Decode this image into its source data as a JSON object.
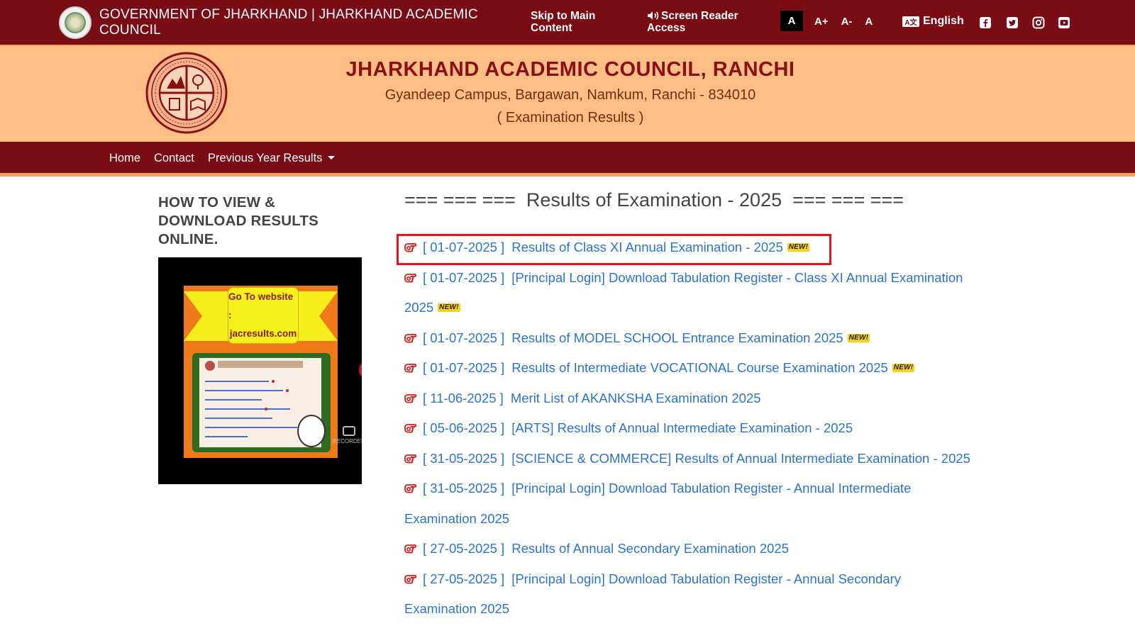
{
  "topbar": {
    "gov_title": "GOVERNMENT OF JHARKHAND | JHARKHAND ACADEMIC COUNCIL",
    "skip_link": "Skip to Main Content",
    "screen_reader": "Screen Reader Access",
    "font_sizes": [
      "A",
      "A+",
      "A-",
      "A"
    ],
    "language": "English",
    "language_icon": "translate-icon",
    "social": [
      "facebook-icon",
      "twitter-icon",
      "instagram-icon",
      "youtube-icon"
    ],
    "bg_color": "#7a0d14"
  },
  "header": {
    "title": "JHARKHAND ACADEMIC COUNCIL, RANCHI",
    "address": "Gyandeep Campus, Bargawan, Namkum, Ranchi - 834010",
    "subtitle": "( Examination Results )",
    "bg_color": "#fdbf86"
  },
  "nav": {
    "home": "Home",
    "contact": "Contact",
    "previous": "Previous Year Results"
  },
  "sidebar": {
    "title": "HOW TO VIEW & DOWNLOAD RESULTS ONLINE.",
    "video_text_1": "Go To website :",
    "video_text_2": "jacresults.com",
    "recorder": "RECORDER"
  },
  "main": {
    "title": "=== === ===  Results of Examination - 2025  === === ===",
    "new_label": "NEW!",
    "results": [
      {
        "date": "[ 01-07-2025 ]",
        "text": "Results of Class XI Annual Examination - 2025",
        "is_new": true
      },
      {
        "date": "[ 01-07-2025 ]",
        "text": "[Principal Login] Download Tabulation Register - Class XI Annual Examination 2025",
        "is_new": true
      },
      {
        "date": "[ 01-07-2025 ]",
        "text": "Results of MODEL SCHOOL Entrance Examination 2025",
        "is_new": true
      },
      {
        "date": "[ 01-07-2025 ]",
        "text": "Results of Intermediate VOCATIONAL Course Examination 2025",
        "is_new": true
      },
      {
        "date": "[ 11-06-2025 ]",
        "text": "Merit List of AKANKSHA Examination 2025",
        "is_new": false
      },
      {
        "date": "[ 05-06-2025 ]",
        "text": "[ARTS]   Results of Annual Intermediate Examination - 2025",
        "is_new": false
      },
      {
        "date": "[ 31-05-2025 ]",
        "text": "[SCIENCE & COMMERCE]   Results of Annual Intermediate Examination - 2025",
        "is_new": false
      },
      {
        "date": "[ 31-05-2025 ]",
        "text": "[Principal Login] Download Tabulation Register - Annual Intermediate Examination 2025",
        "is_new": false
      },
      {
        "date": "[ 27-05-2025 ]",
        "text": "Results of Annual Secondary Examination 2025",
        "is_new": false
      },
      {
        "date": "[ 27-05-2025 ]",
        "text": "[Principal Login] Download Tabulation Register - Annual Secondary Examination 2025",
        "is_new": false
      }
    ],
    "link_color": "#2b74cf",
    "highlight_color": "#e8141c"
  }
}
